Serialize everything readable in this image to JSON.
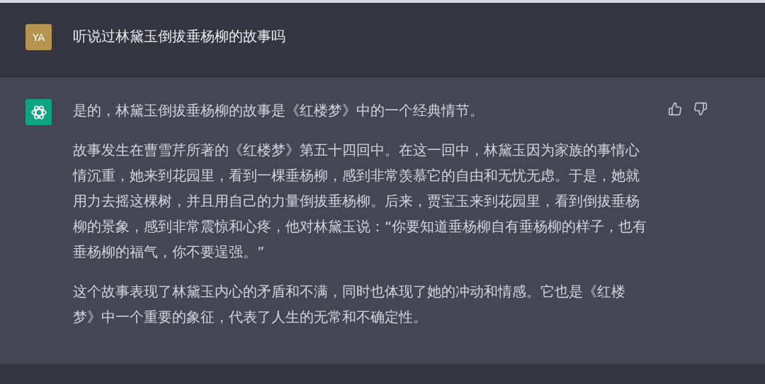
{
  "messages": [
    {
      "kind": "user",
      "avatar": "YA",
      "paragraphs": [
        "听说过林黛玉倒拔垂杨柳的故事吗"
      ]
    },
    {
      "kind": "assistant",
      "paragraphs": [
        "是的，林黛玉倒拔垂杨柳的故事是《红楼梦》中的一个经典情节。",
        "故事发生在曹雪芹所著的《红楼梦》第五十四回中。在这一回中，林黛玉因为家族的事情心情沉重，她来到花园里，看到一棵垂杨柳，感到非常羡慕它的自由和无忧无虑。于是，她就用力去摇这棵树，并且用自己的力量倒拔垂杨柳。后来，贾宝玉来到花园里，看到倒拔垂杨柳的景象，感到非常震惊和心疼，他对林黛玉说：“你要知道垂杨柳自有垂杨柳的样子，也有垂杨柳的福气，你不要逞强。”",
        "这个故事表现了林黛玉内心的矛盾和不满，同时也体现了她的冲动和情感。它也是《红楼梦》中一个重要的象征，代表了人生的无常和不确定性。"
      ]
    }
  ]
}
